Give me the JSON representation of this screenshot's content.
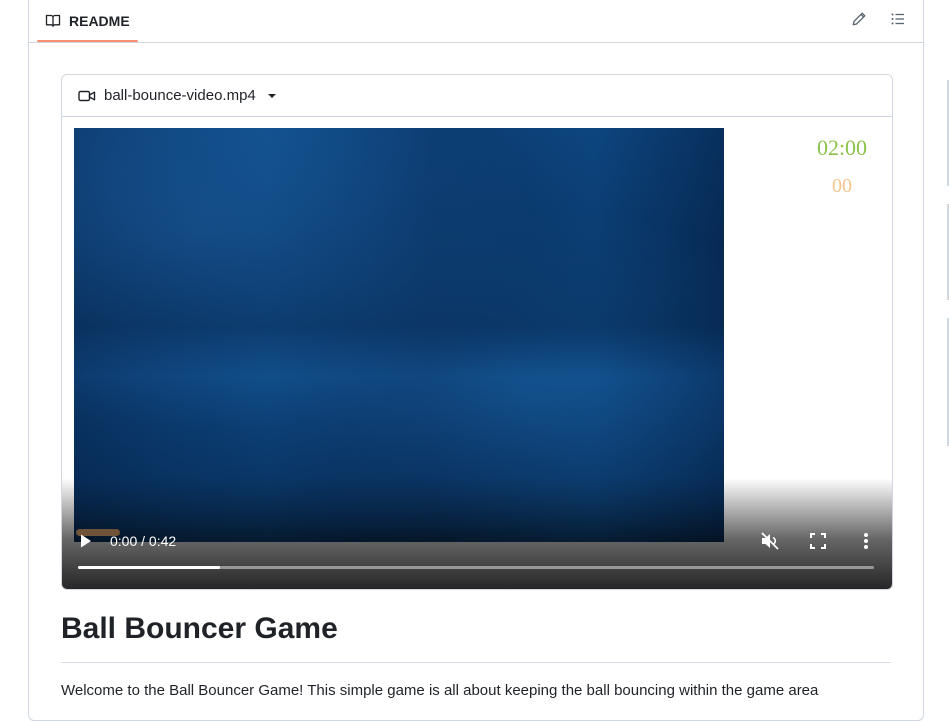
{
  "readme": {
    "tab_label": "README",
    "edit_icon": "pencil-icon",
    "toc_icon": "list-unordered-icon",
    "tab_accent": "#fd8c73"
  },
  "video": {
    "file_icon": "device-camera-video-icon",
    "filename": "ball-bounce-video.mp4",
    "timer_main": "02:00",
    "timer_sub": "00",
    "timer_main_color": "#8bc34a",
    "timer_sub_color": "#f6c48a",
    "time_display": "0:00 / 0:42",
    "buffered_fraction": 0.179,
    "icons": {
      "play": "play-icon",
      "mute": "volume-off-icon",
      "fullscreen": "fullscreen-icon",
      "more": "more-vertical-icon"
    }
  },
  "content": {
    "title": "Ball Bouncer Game",
    "intro": "Welcome to the Ball Bouncer Game! This simple game is all about keeping the ball bouncing within the game area"
  }
}
